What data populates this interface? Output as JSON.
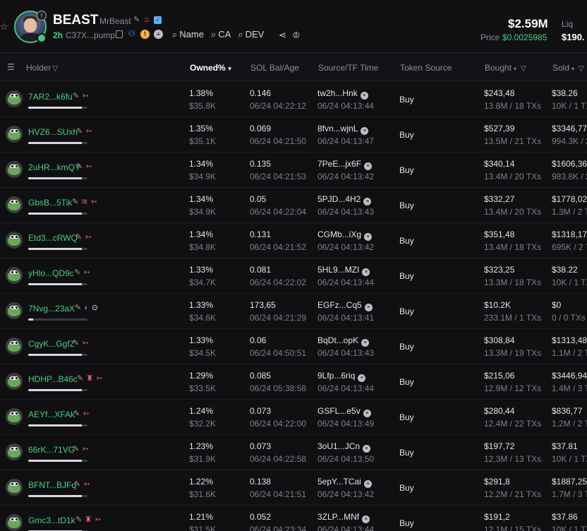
{
  "token": {
    "ticker": "BEAST",
    "name": "MrBeast",
    "age": "2h",
    "contract": "C37X...pump",
    "search_links": [
      "Name",
      "CA",
      "DEV"
    ],
    "market_cap": "$2.59M",
    "liq_label": "Liq",
    "liq_value": "$190.",
    "price_label": "Price",
    "price_value": "$0.0025985"
  },
  "columns": {
    "holder": "Holder",
    "owned": "Owned%",
    "sol": "SOL Bal/Age",
    "source": "Source/TF Time",
    "token_source": "Token Source",
    "bought": "Bought",
    "sold": "Sold"
  },
  "holders": [
    {
      "addr": "7AR2...k6fu",
      "tags": [
        "edit",
        "fish"
      ],
      "bar": 0.9,
      "pct": "1.38%",
      "usd": "$35.8K",
      "sol": "0.146",
      "sol_time": "06/24 04:22:12",
      "src": "tw2h...Hnk",
      "src_time": "06/24 04:13:44",
      "token_source": "Buy",
      "bought": "$243,48",
      "bought_sub": "13.8M / 18 TXs",
      "sold": "$38.26",
      "sold_sub": "10K / 1 TX"
    },
    {
      "addr": "HVZ6...SUxh",
      "tags": [
        "edit",
        "fish"
      ],
      "bar": 0.9,
      "pct": "1.35%",
      "usd": "$35.1K",
      "sol": "0.069",
      "sol_time": "06/24 04:21:50",
      "src": "8fvn...wjnL",
      "src_time": "06/24 04:13:47",
      "token_source": "Buy",
      "bought": "$527,39",
      "bought_sub": "13.5M / 21 TXs",
      "sold": "$3346,77",
      "sold_sub": "994.3K / 2"
    },
    {
      "addr": "2uHR...kmQY",
      "tags": [
        "edit",
        "fish"
      ],
      "bar": 0.9,
      "pct": "1.34%",
      "usd": "$34.9K",
      "sol": "0.135",
      "sol_time": "06/24 04:21:53",
      "src": "7PeE...jx6F",
      "src_time": "06/24 04:13:42",
      "token_source": "Buy",
      "bought": "$340,14",
      "bought_sub": "13.4M / 20 TXs",
      "sold": "$1606,36",
      "sold_sub": "983.8K / 2"
    },
    {
      "addr": "GbsB...5Tik",
      "tags": [
        "edit",
        "layer",
        "fish"
      ],
      "bar": 0.9,
      "pct": "1.34%",
      "usd": "$34.9K",
      "sol": "0.05",
      "sol_time": "06/24 04:22:04",
      "src": "5PJD...4H2",
      "src_time": "06/24 04:13:43",
      "token_source": "Buy",
      "bought": "$332,27",
      "bought_sub": "13.4M / 20 TXs",
      "sold": "$1778,02",
      "sold_sub": "1.3M / 2 T"
    },
    {
      "addr": "Etd3...cRWQ",
      "tags": [
        "edit",
        "fish"
      ],
      "bar": 0.9,
      "pct": "1.34%",
      "usd": "$34.8K",
      "sol": "0.131",
      "sol_time": "06/24 04:21:52",
      "src": "CGMb...iXg",
      "src_time": "06/24 04:13:42",
      "token_source": "Buy",
      "bought": "$351,48",
      "bought_sub": "13.4M / 18 TXs",
      "sold": "$1318,17",
      "sold_sub": "695K / 2 T"
    },
    {
      "addr": "yHlo...QD9c",
      "tags": [
        "edit",
        "fish"
      ],
      "bar": 0.9,
      "pct": "1.33%",
      "usd": "$34.7K",
      "sol": "0.081",
      "sol_time": "06/24 04:22:02",
      "src": "5HL9...MZI",
      "src_time": "06/24 04:13:44",
      "token_source": "Buy",
      "bought": "$323,25",
      "bought_sub": "13.3M / 18 TXs",
      "sold": "$38.22",
      "sold_sub": "10K / 1 TX"
    },
    {
      "addr": "7Nvg...23aX",
      "tags": [
        "edit",
        "moon",
        "target"
      ],
      "bar": 0.08,
      "pct": "1.33%",
      "usd": "$34.6K",
      "sol": "173,65",
      "sol_time": "06/24 04:21:29",
      "src": "EGFz...Cq5",
      "src_time": "06/24 04:13:41",
      "token_source": "Buy",
      "bought": "$10.2K",
      "bought_sub": "233.1M / 1 TXs",
      "sold": "$0",
      "sold_sub": "0 / 0 TXs"
    },
    {
      "addr": "CgyK...GgfZ",
      "tags": [
        "edit",
        "fish"
      ],
      "bar": 0.9,
      "pct": "1.33%",
      "usd": "$34.5K",
      "sol": "0.06",
      "sol_time": "06/24 04:50:51",
      "src": "BqDt...opK",
      "src_time": "06/24 04:13:43",
      "token_source": "Buy",
      "bought": "$308,84",
      "bought_sub": "13.3M / 19 TXs",
      "sold": "$1313,48",
      "sold_sub": "1.1M / 2 T"
    },
    {
      "addr": "HDHP...B46c",
      "tags": [
        "edit",
        "shirt",
        "fish"
      ],
      "bar": 0.9,
      "pct": "1.29%",
      "usd": "$33.5K",
      "sol": "0.085",
      "sol_time": "06/24 05:38:58",
      "src": "9Lfp...6riq",
      "src_time": "06/24 04:13:44",
      "token_source": "Buy",
      "bought": "$215,06",
      "bought_sub": "12.9M / 12 TXs",
      "sold": "$3446,94",
      "sold_sub": "1.4M / 3 T"
    },
    {
      "addr": "AEYf...XFAk",
      "tags": [
        "edit",
        "fish"
      ],
      "bar": 0.9,
      "pct": "1.24%",
      "usd": "$32.2K",
      "sol": "0.073",
      "sol_time": "06/24 04:22:00",
      "src": "GSFL...e5v",
      "src_time": "06/24 04:13:49",
      "token_source": "Buy",
      "bought": "$280,44",
      "bought_sub": "12.4M / 22 TXs",
      "sold": "$836,77",
      "sold_sub": "1.2M / 2 T"
    },
    {
      "addr": "66rK...71VG",
      "tags": [
        "edit",
        "fish"
      ],
      "bar": 0.9,
      "pct": "1.23%",
      "usd": "$31.9K",
      "sol": "0.073",
      "sol_time": "06/24 04:22:58",
      "src": "3oU1...JCn",
      "src_time": "06/24 04:13:50",
      "token_source": "Buy",
      "bought": "$197,72",
      "bought_sub": "12.3M / 13 TXs",
      "sold": "$37.81",
      "sold_sub": "10K / 1 TX"
    },
    {
      "addr": "BFNT...BJFq",
      "tags": [
        "edit",
        "fish"
      ],
      "bar": 0.9,
      "pct": "1.22%",
      "usd": "$31.6K",
      "sol": "0.138",
      "sol_time": "06/24 04:21:51",
      "src": "5epY...TCai",
      "src_time": "06/24 04:13:42",
      "token_source": "Buy",
      "bought": "$291,8",
      "bought_sub": "12.2M / 21 TXs",
      "sold": "$1887,25",
      "sold_sub": "1.7M / 3 T"
    },
    {
      "addr": "Gmc3...tD1k",
      "tags": [
        "edit",
        "shirt",
        "fish"
      ],
      "bar": 0.9,
      "pct": "1.21%",
      "usd": "$31.5K",
      "sol": "0.052",
      "sol_time": "06/24 04:23:34",
      "src": "3ZLP...MNf",
      "src_time": "06/24 04:13:44",
      "token_source": "Buy",
      "bought": "$191,2",
      "bought_sub": "12.1M / 15 TXs",
      "sold": "$37.86",
      "sold_sub": "10K / 1 TX"
    }
  ]
}
